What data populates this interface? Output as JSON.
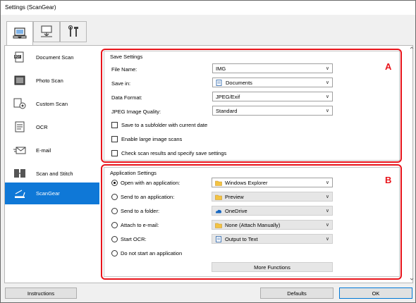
{
  "window": {
    "title": "Settings (ScanGear)"
  },
  "toolbar": {
    "tabs": [
      {
        "icon": "scan-computer-icon"
      },
      {
        "icon": "scan-to-computer-icon"
      },
      {
        "icon": "tools-icon"
      }
    ]
  },
  "sidebar": {
    "items": [
      {
        "label": "Document Scan",
        "icon": "document-scan-icon"
      },
      {
        "label": "Photo Scan",
        "icon": "photo-scan-icon"
      },
      {
        "label": "Custom Scan",
        "icon": "custom-scan-icon"
      },
      {
        "label": "OCR",
        "icon": "ocr-icon"
      },
      {
        "label": "E-mail",
        "icon": "email-icon"
      },
      {
        "label": "Scan and Stitch",
        "icon": "scan-stitch-icon"
      },
      {
        "label": "ScanGear",
        "icon": "scangear-icon"
      }
    ]
  },
  "save_settings": {
    "title": "Save Settings",
    "callout": "A",
    "file_name_label": "File Name:",
    "file_name_value": "IMG",
    "save_in_label": "Save in:",
    "save_in_value": "Documents",
    "data_format_label": "Data Format:",
    "data_format_value": "JPEG/Exif",
    "jpeg_quality_label": "JPEG Image Quality:",
    "jpeg_quality_value": "Standard",
    "subfolder_label": "Save to a subfolder with current date",
    "large_scans_label": "Enable large image scans",
    "check_results_label": "Check scan results and specify save settings"
  },
  "app_settings": {
    "title": "Application Settings",
    "callout": "B",
    "open_app_label": "Open with an application:",
    "open_app_value": "Windows Explorer",
    "send_app_label": "Send to an application:",
    "send_app_value": "Preview",
    "send_folder_label": "Send to a folder:",
    "send_folder_value": "OneDrive",
    "attach_email_label": "Attach to e-mail:",
    "attach_email_value": "None (Attach Manually)",
    "start_ocr_label": "Start OCR:",
    "start_ocr_value": "Output to Text",
    "no_app_label": "Do not start an application",
    "more_functions": "More Functions"
  },
  "footer": {
    "instructions": "Instructions",
    "defaults": "Defaults",
    "ok": "OK"
  },
  "colors": {
    "selection": "#0f78d7",
    "callout_red": "#e8141b"
  }
}
